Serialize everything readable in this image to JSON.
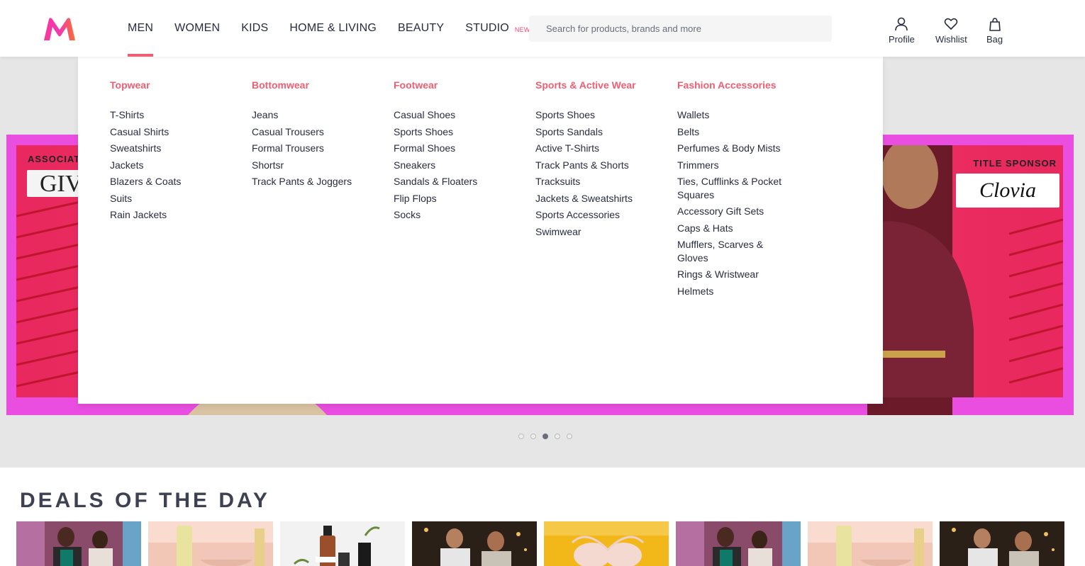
{
  "header": {
    "nav": [
      {
        "label": "MEN",
        "active": true
      },
      {
        "label": "WOMEN"
      },
      {
        "label": "KIDS"
      },
      {
        "label": "HOME & LIVING"
      },
      {
        "label": "BEAUTY"
      },
      {
        "label": "STUDIO",
        "badge": "NEW"
      }
    ],
    "search_placeholder": "Search for products, brands and more",
    "actions": {
      "profile": "Profile",
      "wishlist": "Wishlist",
      "bag": "Bag"
    },
    "icons": {
      "logo": "myntra-logo",
      "profile": "user-icon",
      "wishlist": "heart-icon",
      "bag": "bag-icon"
    }
  },
  "colors": {
    "accent": "#ee5f73",
    "brand_pink": "#ff3f6c",
    "text": "#282c3f",
    "banner": "#e94ee0"
  },
  "mega_menu": {
    "columns": [
      {
        "title": "Topwear",
        "items": [
          "T-Shirts",
          "Casual Shirts",
          "Sweatshirts",
          "Jackets",
          "Blazers & Coats",
          "Suits",
          "Rain Jackets"
        ]
      },
      {
        "title": "Bottomwear",
        "items": [
          "Jeans",
          "Casual Trousers",
          "Formal Trousers",
          "Shortsr",
          "Track Pants & Joggers"
        ]
      },
      {
        "title": "Footwear",
        "items": [
          "Casual Shoes",
          "Sports Shoes",
          "Formal Shoes",
          "Sneakers",
          "Sandals & Floaters",
          "Flip Flops",
          "Socks"
        ]
      },
      {
        "title": "Sports & Active Wear",
        "items": [
          "Sports Shoes",
          "Sports Sandals",
          "Active T-Shirts",
          "Track Pants & Shorts",
          "Tracksuits",
          "Jackets & Sweatshirts",
          "Sports Accessories",
          "Swimwear"
        ]
      },
      {
        "title": "Fashion Accessories",
        "items": [
          "Wallets",
          "Belts",
          "Perfumes & Body Mists",
          "Trimmers",
          "Ties, Cufflinks & Pocket Squares",
          "Accessory Gift Sets",
          "Caps & Hats",
          "Mufflers, Scarves & Gloves",
          "Rings & Wristwear",
          "Helmets"
        ]
      }
    ]
  },
  "banner": {
    "associate_label": "ASSOCIAT",
    "associate_brand": "GIVA",
    "sponsor_label": "TITLE SPONSOR",
    "sponsor_brand": "Clovia",
    "carousel_dots": 5,
    "carousel_active": 3
  },
  "deals": {
    "title": "DEALS OF THE DAY",
    "tiles": [
      "tile-fashion-women",
      "tile-skincare",
      "tile-serum",
      "tile-men-fashion",
      "tile-lingerie",
      "tile-fashion-women",
      "tile-skincare",
      "tile-men-fashion"
    ]
  }
}
